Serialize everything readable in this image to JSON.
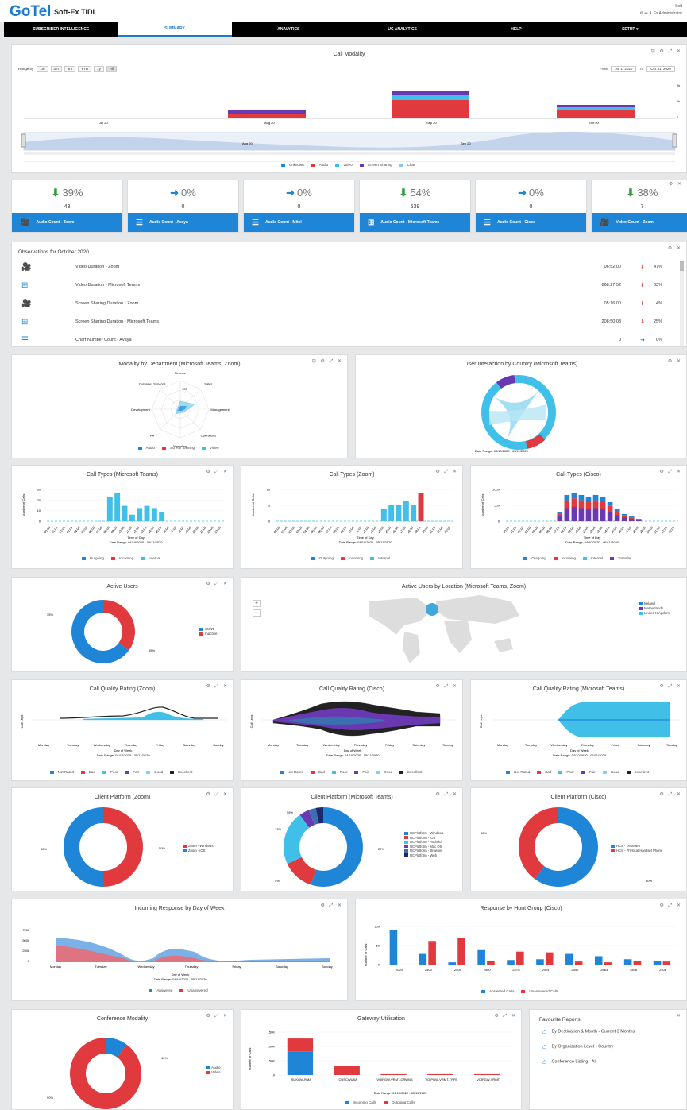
{
  "header": {
    "logo": "GoTel",
    "product": "Soft-Ex TIDI",
    "right_line1": "Soft",
    "right_line2": "⚙ ✚ ⬇ Ex Administrator"
  },
  "nav": [
    {
      "label": "SUBSCRIBER INTELLIGENCE",
      "active": false
    },
    {
      "label": "SUMMARY",
      "active": true
    },
    {
      "label": "ANALYTICS",
      "active": false
    },
    {
      "label": "UC ANALYTICS",
      "active": false
    },
    {
      "label": "HELP",
      "active": false
    },
    {
      "label": "SETUP ▾",
      "active": false
    }
  ],
  "call_modality": {
    "title": "Call Modality",
    "range_label": "Range by",
    "range_buttons": [
      "1m",
      "3m",
      "6m",
      "YTD",
      "1y",
      "All"
    ],
    "from_label": "From",
    "from_value": "Jul 1, 2020",
    "to_label": "To",
    "to_value": "Oct 31, 2020",
    "x_labels": [
      "Jul 20",
      "Aug 20",
      "Sep 20",
      "Oct 20"
    ],
    "nav_labels": [
      "Aug 20",
      "Sep 20"
    ],
    "y_labels": [
      "2k",
      "1k",
      "0"
    ],
    "legend": [
      "Unknown",
      "Audio",
      "Video",
      "Screen Sharing",
      "Chat"
    ]
  },
  "kpis": [
    {
      "arrow": "⬇",
      "dir": "down",
      "pct": "39%",
      "count": "43",
      "icon": "🎥",
      "label": "Audio Count - Zoom"
    },
    {
      "arrow": "➜",
      "dir": "flat",
      "pct": "0%",
      "count": "0",
      "icon": "☰",
      "label": "Audio Count - Avaya"
    },
    {
      "arrow": "➜",
      "dir": "flat",
      "pct": "0%",
      "count": "0",
      "icon": "☰",
      "label": "Audio Count - Mitel"
    },
    {
      "arrow": "⬇",
      "dir": "down",
      "pct": "54%",
      "count": "539",
      "icon": "⊞",
      "label": "Audio Count - Microsoft Teams"
    },
    {
      "arrow": "➜",
      "dir": "flat",
      "pct": "0%",
      "count": "0",
      "icon": "☰",
      "label": "Audio Count - Cisco"
    },
    {
      "arrow": "⬇",
      "dir": "down",
      "pct": "38%",
      "count": "7",
      "icon": "🎥",
      "label": "Video Count - Zoom"
    }
  ],
  "observations": {
    "title": "Observations for October 2020",
    "rows": [
      {
        "icon": "🎥",
        "name": "Video Duration - Zoom",
        "duration": "06:52:00",
        "arrow": "⬇",
        "pct": "47%"
      },
      {
        "icon": "⊞",
        "name": "Video Duration - Microsoft Teams",
        "duration": "868:27:52",
        "arrow": "⬇",
        "pct": "63%"
      },
      {
        "icon": "🎥",
        "name": "Screen Sharing Duration - Zoom",
        "duration": "05:16:00",
        "arrow": "⬇",
        "pct": "4%"
      },
      {
        "icon": "⊞",
        "name": "Screen Sharing Duration - Microsoft Teams",
        "duration": "208:50:08",
        "arrow": "⬇",
        "pct": "25%"
      },
      {
        "icon": "☰",
        "name": "Chart Number Count - Avaya",
        "duration": "0",
        "arrow": "➜",
        "pct": "0%"
      }
    ]
  },
  "modality_dept": {
    "title": "Modality by Department (Microsoft Teams, Zoom)",
    "axes": [
      "Finance",
      "Sales",
      "Management",
      "Operations",
      "Marketing",
      "HR",
      "Development",
      "Customer Services"
    ],
    "scale": "100",
    "legend": [
      "Audio",
      "Screen Sharing",
      "Video"
    ]
  },
  "user_interaction": {
    "title": "User Interaction by Country (Microsoft Teams)",
    "date_range": "Date Range: 04/10/2020 - 05/11/2020"
  },
  "call_types": [
    {
      "title": "Call Types (Microsoft Teams)",
      "y_label": "Number of Calls",
      "x_label": "Time of Day",
      "date_range": "Date Range: 04/10/2020 - 05/11/2020",
      "legend": [
        "Outgoing",
        "Incoming",
        "Internal"
      ],
      "values": [
        0,
        0,
        0,
        0,
        0,
        0,
        0,
        0,
        22,
        26,
        14,
        6,
        12,
        14,
        12,
        8,
        0,
        0,
        0,
        0,
        0,
        0,
        0,
        0
      ],
      "y_ticks": [
        "30",
        "20",
        "10",
        "0"
      ]
    },
    {
      "title": "Call Types (Zoom)",
      "y_label": "Number of Calls",
      "x_label": "Time of Day",
      "date_range": "Date Range: 04/10/2020 - 05/11/2020",
      "legend": [
        "Outgoing",
        "Incoming",
        "Internal"
      ],
      "values": [
        0,
        0,
        0,
        0,
        0,
        0,
        0,
        0,
        0,
        0,
        0,
        0,
        0,
        0,
        3,
        4,
        4,
        5,
        4,
        7,
        0,
        0,
        0,
        0
      ],
      "y_ticks": [
        "10",
        "5",
        "0"
      ]
    },
    {
      "title": "Call Types (Cisco)",
      "y_label": "Number of Calls",
      "x_label": "Time of Day",
      "date_range": "Date Range: 04/10/2020 - 05/11/2020",
      "legend": [
        "Outgoing",
        "Incoming",
        "Internal",
        "Transfer"
      ],
      "values": [
        0,
        0,
        0,
        0,
        0,
        0,
        0,
        8,
        22,
        24,
        22,
        20,
        22,
        20,
        16,
        10,
        6,
        4,
        2,
        0,
        0,
        0,
        0,
        0
      ],
      "y_ticks": [
        "1000",
        "500",
        "0"
      ]
    }
  ],
  "active_users": {
    "title": "Active Users",
    "legend": [
      "Active",
      "Inactive"
    ],
    "labels": [
      "35%",
      "65%"
    ],
    "values": [
      35,
      65
    ]
  },
  "active_location": {
    "title": "Active Users by Location (Microsoft Teams, Zoom)",
    "legend": [
      "Ireland",
      "Netherlands",
      "United Kingdom"
    ],
    "zoom_in": "+",
    "zoom_out": "−"
  },
  "quality": [
    {
      "title": "Call Quality Rating (Zoom)",
      "y_label": "Call Legs",
      "x_label": "Day of Week",
      "date_range": "Date Range: 04/10/2020 - 05/11/2020"
    },
    {
      "title": "Call Quality Rating (Cisco)",
      "y_label": "Call Legs",
      "x_label": "Day of Week",
      "date_range": "Date Range: 04/10/2020 - 05/11/2020"
    },
    {
      "title": "Call Quality Rating (Microsoft Teams)",
      "y_label": "Call Legs",
      "x_label": "Day of Week",
      "date_range": "Date Range: 04/10/2020 - 05/11/2020"
    }
  ],
  "days": [
    "Monday",
    "Tuesday",
    "Wednesday",
    "Thursday",
    "Friday",
    "Saturday",
    "Sunday"
  ],
  "quality_legend": [
    "Not Rated",
    "Bad",
    "Poor",
    "Fair",
    "Good",
    "Excellent"
  ],
  "platform": [
    {
      "title": "Client Platform (Zoom)",
      "legend": [
        "Zoom - Windows",
        "Zoom - iOS"
      ],
      "values": [
        50,
        50
      ],
      "labels": [
        "50%",
        "50%"
      ]
    },
    {
      "title": "Client Platform (Microsoft Teams)",
      "legend": [
        "UCPlatform - Windows",
        "UCPlatform - iOS",
        "UCPlatform - Android",
        "UCPlatform - Mac OS",
        "UCPlatform - Browser",
        "UCPlatform - Web"
      ],
      "values": [
        55,
        13,
        22,
        4,
        3,
        3
      ],
      "labels": [
        "55%",
        "13%",
        "22%",
        "4%"
      ]
    },
    {
      "title": "Client Platform (Cisco)",
      "legend": [
        "HCS - Unknown",
        "HCS - Physical Handset Phone"
      ],
      "values": [
        60,
        40
      ],
      "labels": [
        "60%",
        "40%"
      ]
    }
  ],
  "incoming": {
    "title": "Incoming Response by Day of Week",
    "x_label": "Day of Week",
    "date_range": "Date Range: 04/10/2020 - 05/11/2020",
    "legend": [
      "Answered",
      "Unanswered"
    ],
    "y_ticks": [
      "750k",
      "500k",
      "250k",
      "0"
    ]
  },
  "hunt": {
    "title": "Response by Hunt Group (Cisco)",
    "y_label": "Number of Calls",
    "legend": [
      "Answered Calls",
      "Unanswered Calls"
    ],
    "categories": [
      "2020",
      "2400",
      "2404",
      "2400",
      "24TS",
      "2024",
      "2442",
      "2663",
      "2406",
      "2406"
    ],
    "answered": [
      90,
      28,
      6,
      38,
      12,
      14,
      28,
      22,
      14,
      10
    ],
    "unanswered": [
      0,
      62,
      70,
      10,
      34,
      32,
      8,
      6,
      10,
      8
    ],
    "y_ticks": [
      "100",
      "50",
      "0"
    ]
  },
  "conf_modality": {
    "title": "Conference Modality",
    "legend": [
      "Audio",
      "Video"
    ],
    "labels": [
      "10%",
      "90%"
    ],
    "values": [
      10,
      90
    ]
  },
  "gateway": {
    "title": "Gateway Utilisation",
    "y_label": "Number of Calls",
    "date_range": "Date Range: 04/10/2020 - 05/11/2020",
    "legend": [
      "Incoming Calls",
      "Outgoing Calls"
    ],
    "categories": [
      "SUKGW-RMA",
      "CUSCWUSA",
      "VOIPGW-VRMT-CRWNS",
      "VOIPGW-VRMT-TRFE",
      "VOIPGW-VRMT"
    ],
    "incoming": [
      55,
      0,
      0,
      0,
      0
    ],
    "outgoing": [
      30,
      22,
      2,
      2,
      2
    ],
    "y_ticks": [
      "150K",
      "100K",
      "50K",
      "0"
    ]
  },
  "favourites": {
    "title": "Favourite Reports",
    "items": [
      "By Destination & Month - Current 3 Months",
      "By Organisation Level - Country",
      "Conference Listing - All"
    ]
  },
  "colors": {
    "blue": "#1f86d7",
    "red": "#e0393e",
    "cyan": "#40c0e8",
    "purple": "#6a38b0",
    "dark": "#222"
  }
}
